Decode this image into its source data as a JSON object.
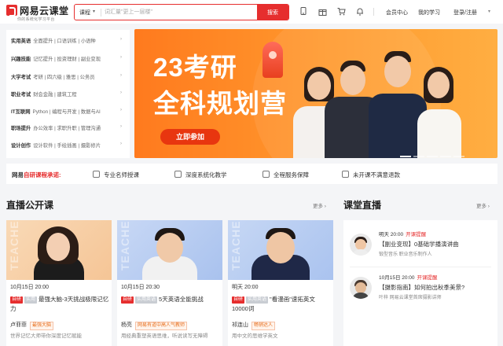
{
  "header": {
    "logo_name": "网易云课堂",
    "logo_slogan": "你的系统化学习平台",
    "search_category": "课程",
    "search_placeholder": "词汇量\"更上一层楼\"",
    "search_button": "搜索",
    "links": [
      "会员中心",
      "我的学习",
      "登录/注册"
    ],
    "icons": [
      "download-icon",
      "gift-icon",
      "cart-icon",
      "bell-icon"
    ]
  },
  "categories": [
    {
      "main": "实用英语",
      "subs": "全面提升 | 口语训练 | 小语种"
    },
    {
      "main": "兴趣技能",
      "subs": "记忆提升 | 投资理财 | 副业变现"
    },
    {
      "main": "大学考试",
      "subs": "考研 | 四六级 | 雅思 | 公务员"
    },
    {
      "main": "职业考试",
      "subs": "财会金融 | 建筑工程"
    },
    {
      "main": "IT互联网",
      "subs": "Python | 编程与开发 | 数据与AI"
    },
    {
      "main": "职场提升",
      "subs": "办公效率 | 求职升职 | 管理沟通"
    },
    {
      "main": "设计创作",
      "subs": "设计软件 | 手绘插画 | 摄影修片"
    }
  ],
  "banner": {
    "title_line1": "23考研",
    "title_line2": "全科规划营",
    "cta": "立即参加",
    "slide_count": 5,
    "active_slide": 1
  },
  "promise": {
    "prefix": "网易",
    "highlight": "自研课程承诺:",
    "items": [
      "专业名师授课",
      "深度系统化教学",
      "全程服务保障",
      "未开课不满意退款"
    ]
  },
  "live_section": {
    "title": "直播公开课",
    "more": "更多",
    "cards": [
      {
        "time": "10月15日 20:00",
        "tags": [
          "自研",
          "实用"
        ],
        "title": "最强大脑-3天挑战极限记忆力",
        "teacher": "卢菲菲",
        "badge": "最强大脑",
        "desc": "世界记忆大师带你深度记忆赋能"
      },
      {
        "time": "10月15日 20:30",
        "tags": [
          "自研",
          "实用英语"
        ],
        "title": "5天英语全能挑战",
        "teacher": "杨亮",
        "badge": "网易有道中高人气教师",
        "desc": "用经典重塑英语思维，听说读写无障碍"
      },
      {
        "time": "明天 20:00",
        "tags": [
          "自研",
          "实用英语"
        ],
        "title": "\"看漫画\"速拓英文10000词",
        "teacher": "祁连山",
        "badge": "畅销达人",
        "desc": "用中文的思维学英文"
      }
    ]
  },
  "classroom_section": {
    "title": "课堂直播",
    "more": "更多",
    "items": [
      {
        "time": "明天 20:00",
        "status": "开课提醒",
        "title": "【副业变现】0基础学播演讲曲",
        "desc": "锻型音乐  职业音乐制作人"
      },
      {
        "time": "10月15日 20:00",
        "status": "开课提醒",
        "title": "【摄影指南】如何拍出秋季美景?",
        "desc": "叶梓 网易云课堂首席摄影讲师"
      }
    ]
  },
  "colors": {
    "brand_red": "#e62e2e",
    "banner_orange": "#ff8a26"
  }
}
